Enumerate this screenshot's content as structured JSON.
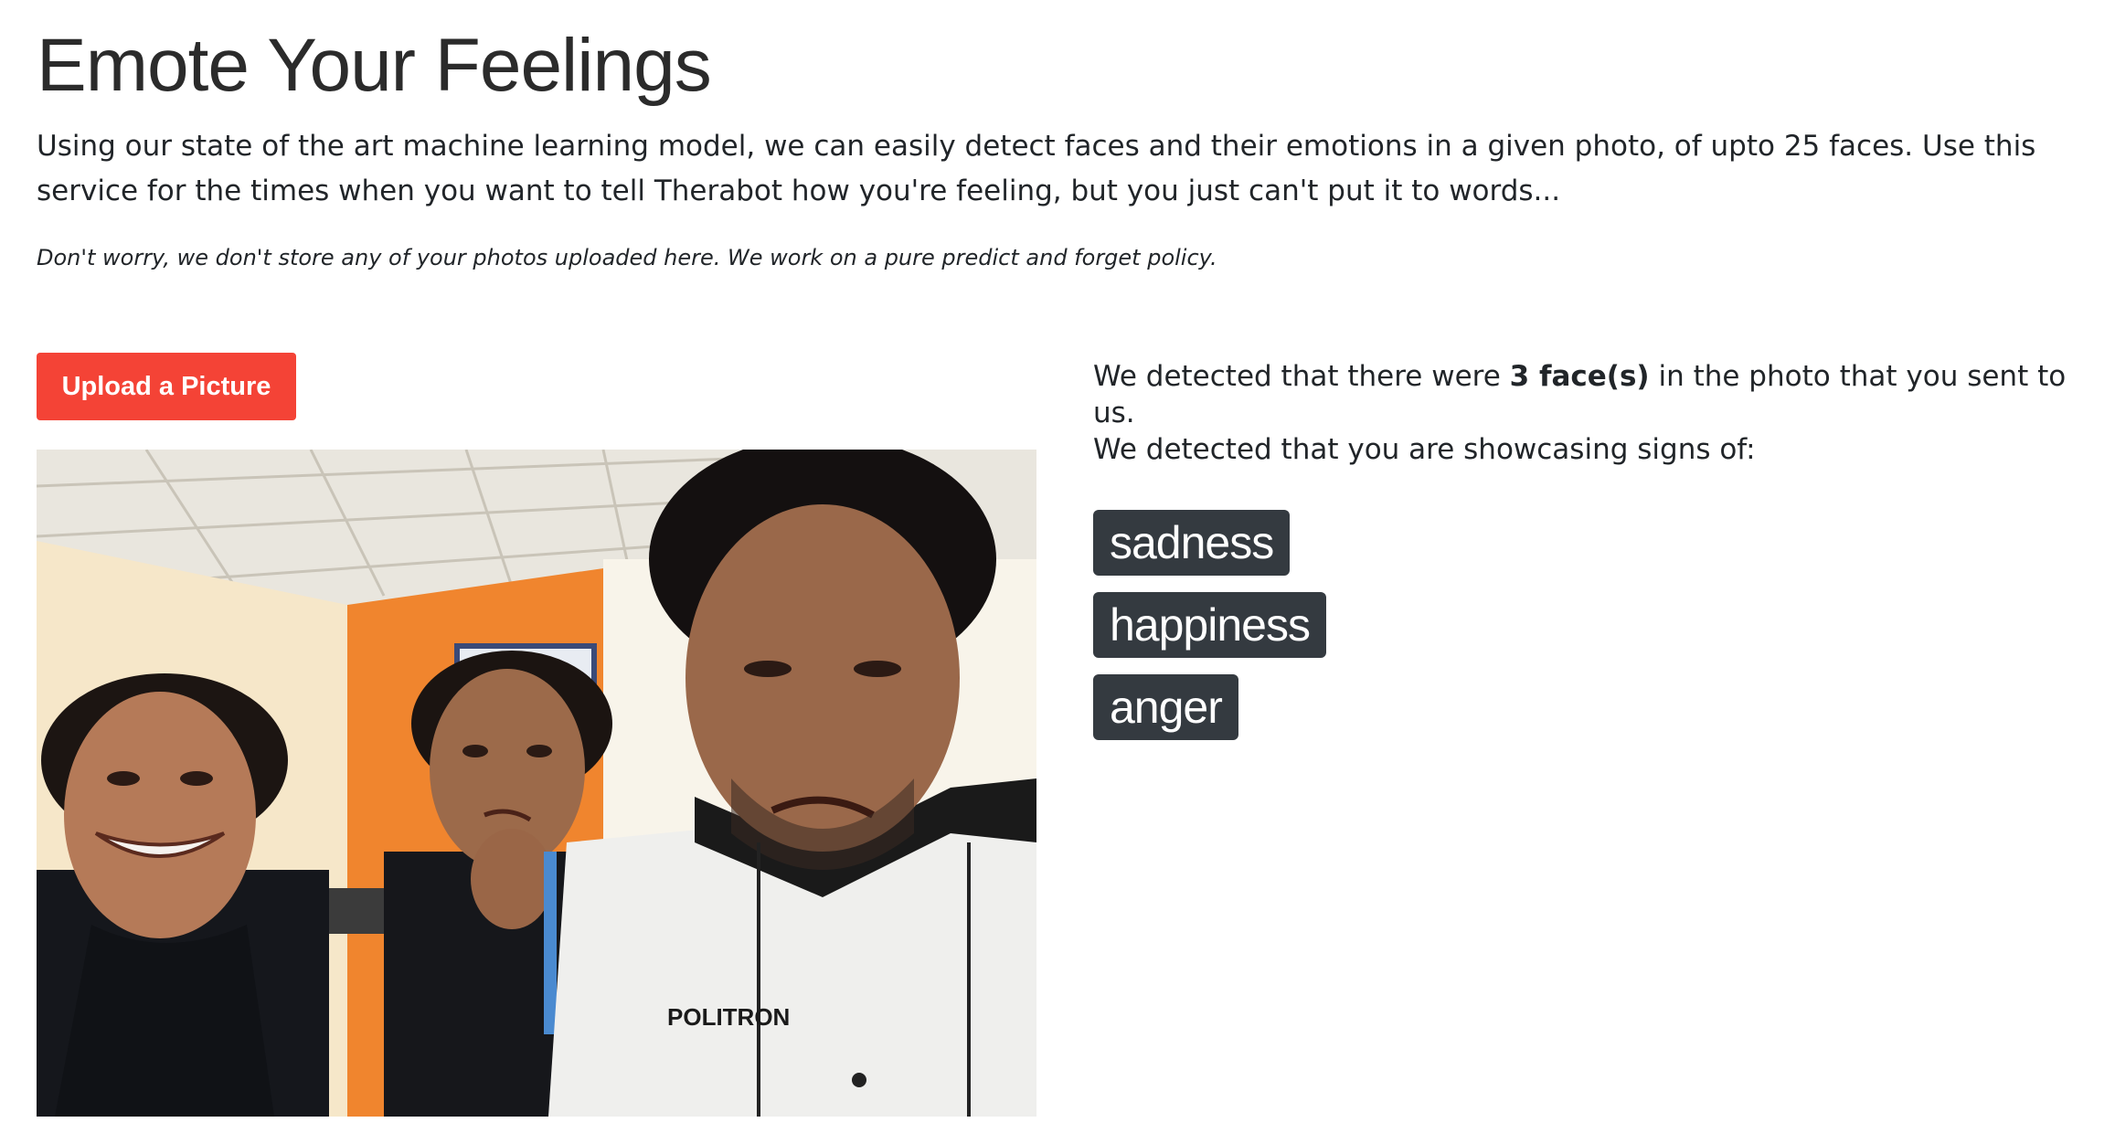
{
  "page": {
    "title": "Emote Your Feelings",
    "intro": "Using our state of the art machine learning model, we can easily detect faces and their emotions in a given photo, of upto 25 faces. Use this service for the times when you want to tell Therabot how you're feeling, but you just can't put it to words...",
    "privacy_note": "Don't worry, we don't store any of your photos uploaded here. We work on a pure predict and forget policy."
  },
  "upload": {
    "button_label": "Upload a Picture"
  },
  "photo": {
    "shirt_print": "POLITRON"
  },
  "results": {
    "faces_prefix": "We detected that there were ",
    "faces_count": "3 face(s)",
    "faces_suffix": " in the photo that you sent to us.",
    "signs_text": "We detected that you are showcasing signs of:",
    "emotions": [
      "sadness",
      "happiness",
      "anger"
    ]
  },
  "colors": {
    "upload_button": "#f44336",
    "badge_background": "#343a40",
    "badge_text": "#ffffff",
    "wall_orange": "#f0852e"
  }
}
